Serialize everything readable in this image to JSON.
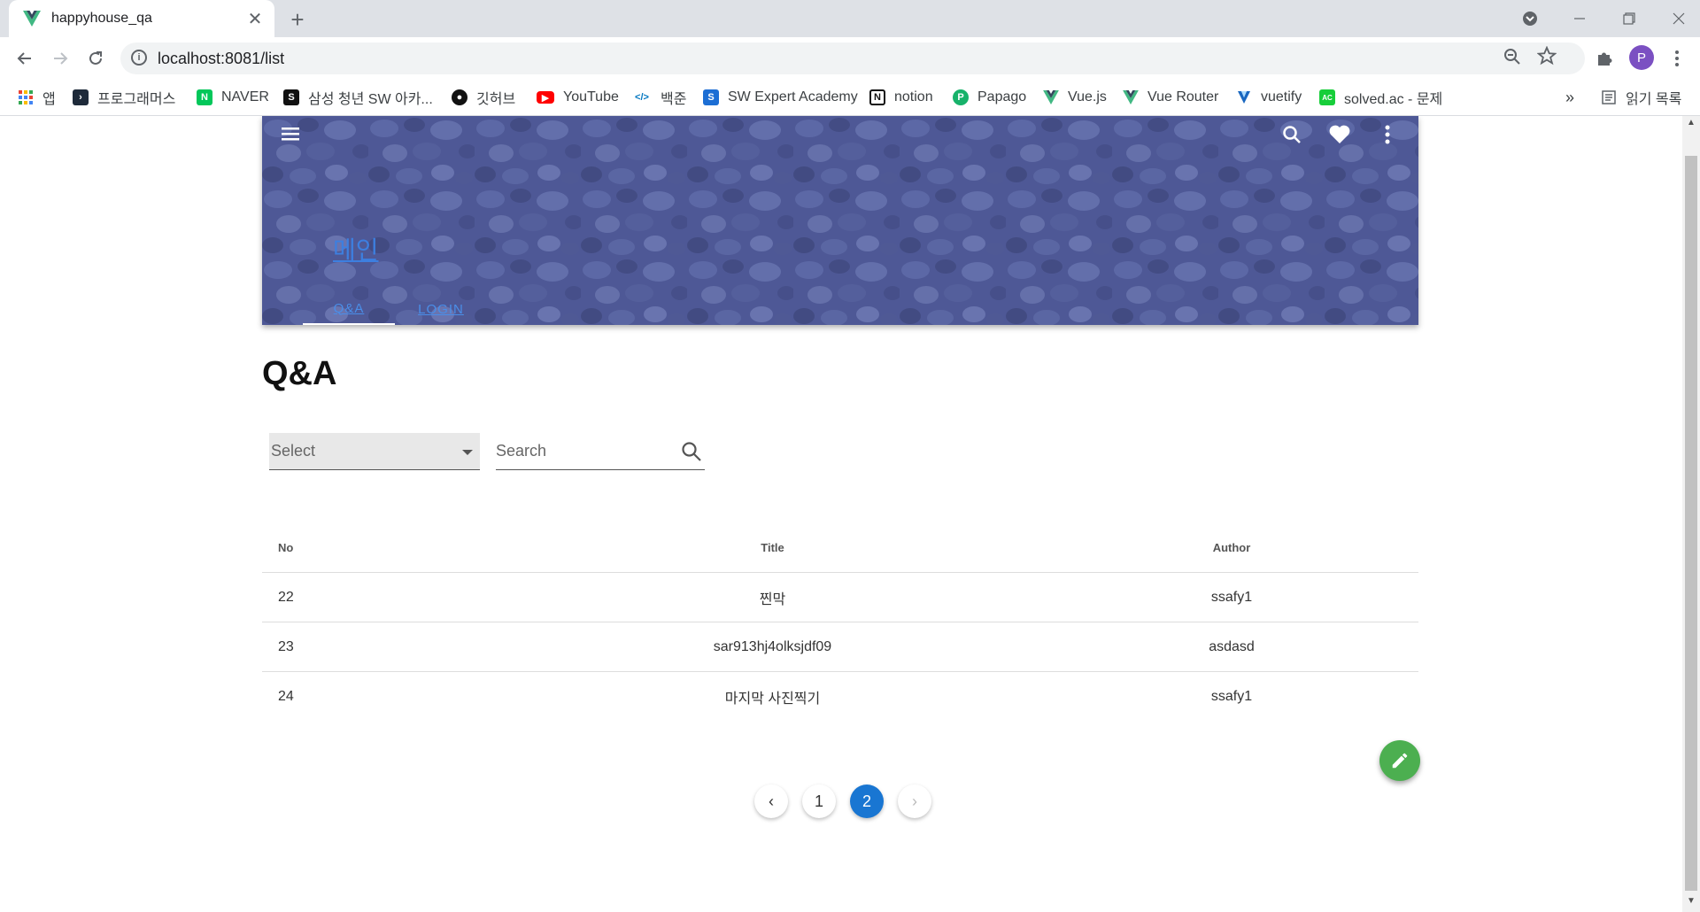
{
  "browser": {
    "tab_title": "happyhouse_qa",
    "tab_close": "✕",
    "new_tab": "+",
    "url": "localhost:8081/list",
    "profile_initial": "P",
    "bookmarks": [
      {
        "label": "앱",
        "icon": "apps-grid-icon",
        "color": "#ea4335"
      },
      {
        "label": "프로그래머스",
        "icon": "programmers-icon",
        "color": "#1e2a3a"
      },
      {
        "label": "NAVER",
        "icon": "naver-icon",
        "color": "#03c75a"
      },
      {
        "label": "삼성 청년 SW 아카...",
        "icon": "ssafy-icon",
        "color": "#111111"
      },
      {
        "label": "깃허브",
        "icon": "github-icon",
        "color": "#111111"
      },
      {
        "label": "YouTube",
        "icon": "youtube-icon",
        "color": "#ff0000"
      },
      {
        "label": "백준",
        "icon": "baekjoon-icon",
        "color": "#0076c0"
      },
      {
        "label": "SW Expert Academy",
        "icon": "swea-icon",
        "color": "#1c6ed4"
      },
      {
        "label": "notion",
        "icon": "notion-icon",
        "color": "#111111"
      },
      {
        "label": "Papago",
        "icon": "papago-icon",
        "color": "#17b26a"
      },
      {
        "label": "Vue.js",
        "icon": "vue-icon",
        "color": "#41b883"
      },
      {
        "label": "Vue Router",
        "icon": "vue-icon",
        "color": "#41b883"
      },
      {
        "label": "vuetify",
        "icon": "vuetify-icon",
        "color": "#1867c0"
      },
      {
        "label": "solved.ac - 문제",
        "icon": "solvedac-icon",
        "color": "#17ce3a"
      }
    ],
    "bookmarks_overflow": "»",
    "reading_list": "읽기 목록"
  },
  "header": {
    "brand": "메인",
    "tabs": [
      {
        "label": "Q&A",
        "active": true
      },
      {
        "label": "LOGIN",
        "active": false
      }
    ],
    "accent": "#3d7fe0"
  },
  "main": {
    "title": "Q&A",
    "select_placeholder": "Select",
    "search_placeholder": "Search",
    "table": {
      "headers": {
        "no": "No",
        "title": "Title",
        "author": "Author"
      },
      "rows": [
        {
          "no": "22",
          "title": "찐막",
          "author": "ssafy1"
        },
        {
          "no": "23",
          "title": "sar913hj4olksjdf09",
          "author": "asdasd"
        },
        {
          "no": "24",
          "title": "마지막 사진찍기",
          "author": "ssafy1"
        }
      ]
    },
    "pagination": {
      "pages": [
        "1",
        "2"
      ],
      "current": "2",
      "prev": "‹",
      "next": "›"
    },
    "fab_color": "#4caf50",
    "active_page_color": "#1976d2"
  }
}
